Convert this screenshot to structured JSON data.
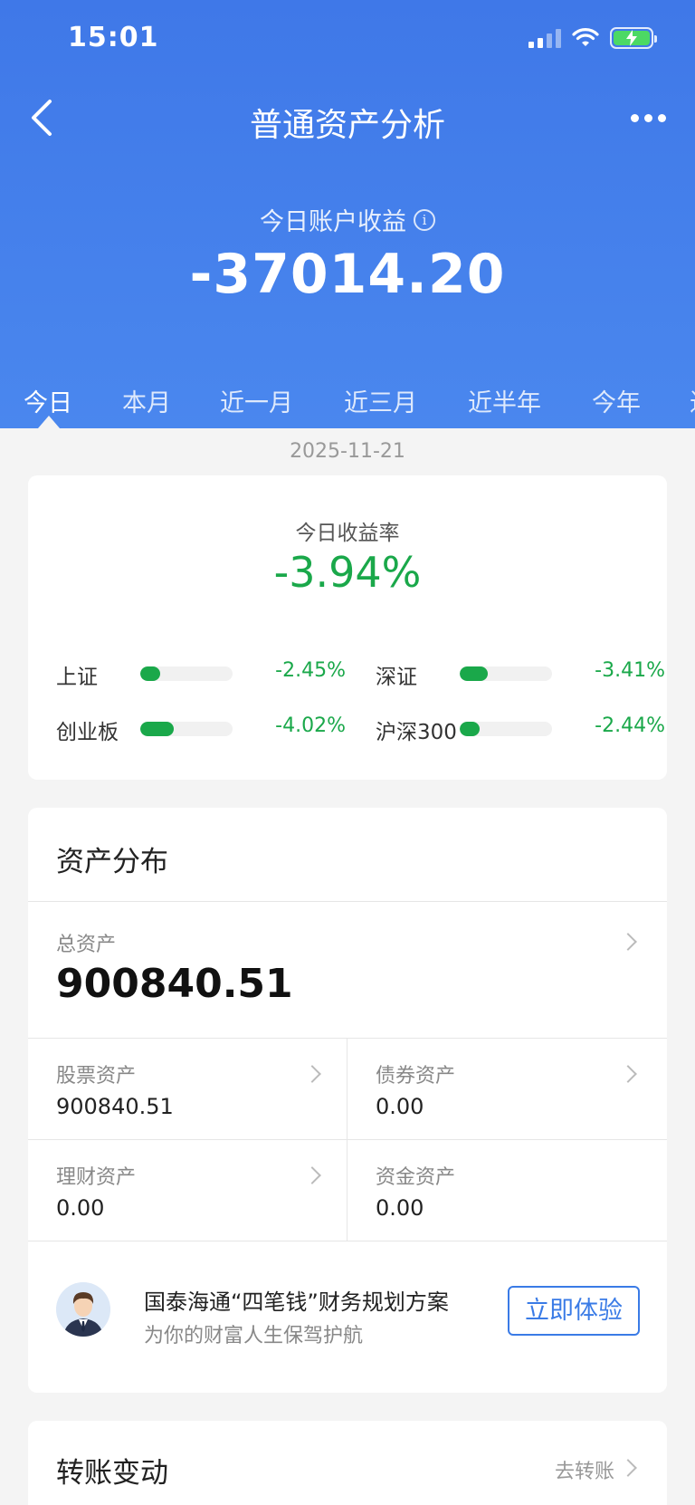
{
  "status_bar": {
    "time": "15:01"
  },
  "nav": {
    "title": "普通资产分析"
  },
  "income": {
    "label": "今日账户收益",
    "value": "-37014.20"
  },
  "tabs": [
    {
      "label": "今日",
      "active": true
    },
    {
      "label": "本月"
    },
    {
      "label": "近一月"
    },
    {
      "label": "近三月"
    },
    {
      "label": "近半年"
    },
    {
      "label": "今年"
    },
    {
      "label": "近"
    }
  ],
  "date": "2025-11-21",
  "rate": {
    "label": "今日收益率",
    "value": "-3.94%",
    "color": "#1aa84a",
    "indices": [
      {
        "name": "上证",
        "value": "-2.45%",
        "fill_fraction": 0.22
      },
      {
        "name": "深证",
        "value": "-3.41%",
        "fill_fraction": 0.3
      },
      {
        "name": "创业板",
        "value": "-4.02%",
        "fill_fraction": 0.36
      },
      {
        "name": "沪深300",
        "value": "-2.44%",
        "fill_fraction": 0.22
      }
    ]
  },
  "assets": {
    "title": "资产分布",
    "total": {
      "label": "总资产",
      "value": "900840.51"
    },
    "cells": [
      {
        "label": "股票资产",
        "value": "900840.51"
      },
      {
        "label": "债券资产",
        "value": "0.00"
      },
      {
        "label": "理财资产",
        "value": "0.00"
      },
      {
        "label": "资金资产",
        "value": "0.00"
      }
    ],
    "promo": {
      "title": "国泰海通“四笔钱”财务规划方案",
      "subtitle": "为你的财富人生保驾护航",
      "button": "立即体验"
    }
  },
  "transfer": {
    "title": "转账变动",
    "link": "去转账"
  },
  "colors": {
    "header_blue": "#4580ea",
    "accent_blue": "#3a7be6",
    "down_green": "#1aa84a"
  }
}
